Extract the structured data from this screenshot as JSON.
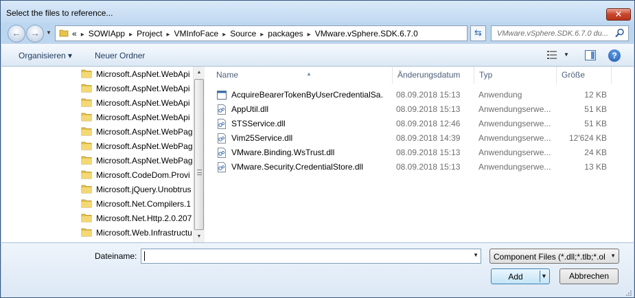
{
  "window": {
    "title": "Select the files to reference...",
    "close_label": "✕"
  },
  "address": {
    "overflow": "«",
    "path": [
      "SOWIApp",
      "Project",
      "VMInfoFace",
      "Source",
      "packages",
      "VMware.vSphere.SDK.6.7.0"
    ],
    "separator": "▸"
  },
  "search": {
    "placeholder": "VMware.vSphere.SDK.6.7.0 du..."
  },
  "toolbar": {
    "organize_label": "Organisieren ▾",
    "new_folder_label": "Neuer Ordner"
  },
  "tree": {
    "items": [
      "Microsoft.AspNet.WebApi",
      "Microsoft.AspNet.WebApi",
      "Microsoft.AspNet.WebApi",
      "Microsoft.AspNet.WebApi",
      "Microsoft.AspNet.WebPag",
      "Microsoft.AspNet.WebPag",
      "Microsoft.AspNet.WebPag",
      "Microsoft.CodeDom.Provi",
      "Microsoft.jQuery.Unobtrus",
      "Microsoft.Net.Compilers.1",
      "Microsoft.Net.Http.2.0.207",
      "Microsoft.Web.Infrastructu"
    ]
  },
  "columns": {
    "name": "Name",
    "date": "Änderungsdatum",
    "type": "Typ",
    "size": "Größe"
  },
  "files": [
    {
      "name": "AcquireBearerTokenByUserCredentialSa...",
      "date": "08.09.2018 15:13",
      "type": "Anwendung",
      "size": "12 KB",
      "icon": "application-icon"
    },
    {
      "name": "AppUtil.dll",
      "date": "08.09.2018 15:13",
      "type": "Anwendungserwe...",
      "size": "51 KB",
      "icon": "dll-file-icon"
    },
    {
      "name": "STSService.dll",
      "date": "08.09.2018 12:46",
      "type": "Anwendungserwe...",
      "size": "51 KB",
      "icon": "dll-file-icon"
    },
    {
      "name": "Vim25Service.dll",
      "date": "08.09.2018 14:39",
      "type": "Anwendungserwe...",
      "size": "12'624 KB",
      "icon": "dll-file-icon"
    },
    {
      "name": "VMware.Binding.WsTrust.dll",
      "date": "08.09.2018 15:13",
      "type": "Anwendungserwe...",
      "size": "24 KB",
      "icon": "dll-file-icon"
    },
    {
      "name": "VMware.Security.CredentialStore.dll",
      "date": "08.09.2018 15:13",
      "type": "Anwendungserwe...",
      "size": "13 KB",
      "icon": "dll-file-icon"
    }
  ],
  "footer": {
    "filename_label": "Dateiname:",
    "filename_value": "",
    "filter_value": "Component Files (*.dll;*.tlb;*.ol",
    "add_label": "Add",
    "cancel_label": "Abbrechen"
  },
  "colors": {
    "accent": "#1e395b",
    "frame": "#bcd6f0",
    "close": "#c7452a",
    "folder": "#e8c34a"
  }
}
